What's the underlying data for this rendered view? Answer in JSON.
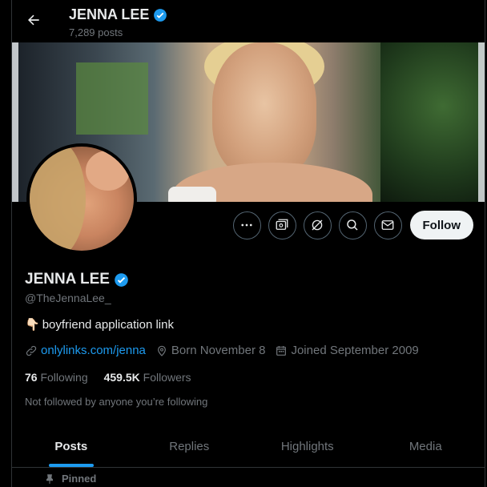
{
  "header": {
    "display_name": "JENNA LEE",
    "posts_count": "7,289 posts"
  },
  "profile": {
    "display_name": "JENNA LEE",
    "handle": "@TheJennaLee_",
    "bio_emoji": "👇🏻",
    "bio_text": "boyfriend application link",
    "link": "onlylinks.com/jenna",
    "birthday": "Born November 8",
    "joined": "Joined September 2009",
    "following_count": "76",
    "following_label": "Following",
    "followers_count": "459.5K",
    "followers_label": "Followers",
    "followed_by_note": "Not followed by anyone you’re following"
  },
  "actions": {
    "follow_label": "Follow",
    "icons": [
      "more-icon",
      "subscribe-icon",
      "grok-icon",
      "search-icon",
      "message-icon"
    ]
  },
  "tabs": [
    {
      "label": "Posts",
      "active": true
    },
    {
      "label": "Replies",
      "active": false
    },
    {
      "label": "Highlights",
      "active": false
    },
    {
      "label": "Media",
      "active": false
    }
  ],
  "pinned_label": "Pinned",
  "colors": {
    "background": "#000000",
    "accent": "#1d9bf0",
    "text": "#e7e9ea",
    "muted": "#71767b",
    "border": "#2f3336",
    "follow_button": "#eff3f4"
  }
}
